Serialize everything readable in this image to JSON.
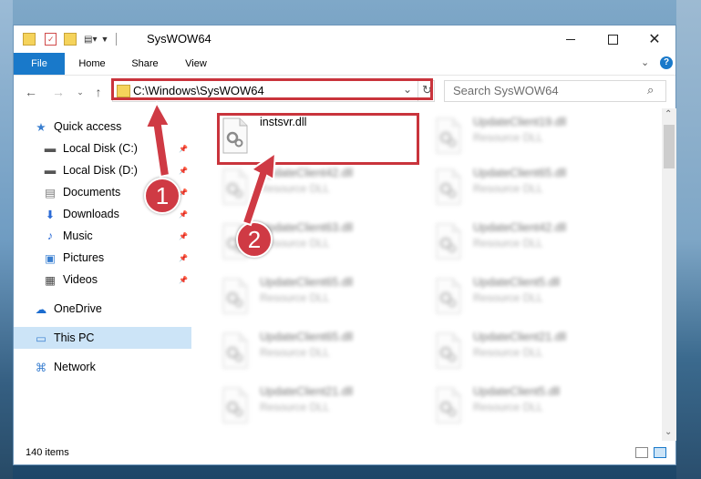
{
  "window": {
    "title": "SysWOW64"
  },
  "ribbon": {
    "tabs": [
      "File",
      "Home",
      "Share",
      "View"
    ]
  },
  "address": {
    "path": "C:\\Windows\\SysWOW64"
  },
  "search": {
    "placeholder": "Search SysWOW64"
  },
  "nav": {
    "items": [
      {
        "label": "Quick access",
        "icon": "star-icon"
      },
      {
        "label": "Local Disk (C:)",
        "icon": "drive-icon",
        "pinned": true
      },
      {
        "label": "Local Disk (D:)",
        "icon": "drive-icon",
        "pinned": true
      },
      {
        "label": "Documents",
        "icon": "documents-icon",
        "pinned": true
      },
      {
        "label": "Downloads",
        "icon": "download-icon",
        "pinned": true
      },
      {
        "label": "Music",
        "icon": "music-icon",
        "pinned": true
      },
      {
        "label": "Pictures",
        "icon": "pictures-icon",
        "pinned": true
      },
      {
        "label": "Videos",
        "icon": "videos-icon",
        "pinned": true
      },
      {
        "label": "OneDrive",
        "icon": "cloud-icon"
      },
      {
        "label": "This PC",
        "icon": "computer-icon",
        "selected": true
      },
      {
        "label": "Network",
        "icon": "network-icon"
      }
    ]
  },
  "files": {
    "col1": [
      {
        "name": "instsvr.dll",
        "type": ""
      },
      {
        "name": "UpdateClient42.dll",
        "type": "Resource DLL"
      },
      {
        "name": "UpdateClient63.dll",
        "type": "Resource DLL"
      },
      {
        "name": "UpdateClient65.dll",
        "type": "Resource DLL"
      },
      {
        "name": "UpdateClient65.dll",
        "type": "Resource DLL"
      },
      {
        "name": "UpdateClient21.dll",
        "type": "Resource DLL"
      }
    ],
    "col2": [
      {
        "name": "UpdateClient19.dll",
        "type": "Resource DLL"
      },
      {
        "name": "UpdateClient65.dll",
        "type": "Resource DLL"
      },
      {
        "name": "UpdateClient42.dll",
        "type": "Resource DLL"
      },
      {
        "name": "UpdateClient5.dll",
        "type": "Resource DLL"
      },
      {
        "name": "UpdateClient21.dll",
        "type": "Resource DLL"
      },
      {
        "name": "UpdateClient5.dll",
        "type": "Resource DLL"
      }
    ]
  },
  "status": {
    "count": "140 items"
  },
  "badges": {
    "one": "1",
    "two": "2"
  },
  "colors": {
    "accent": "#1979ca",
    "highlight": "#c9343c"
  }
}
